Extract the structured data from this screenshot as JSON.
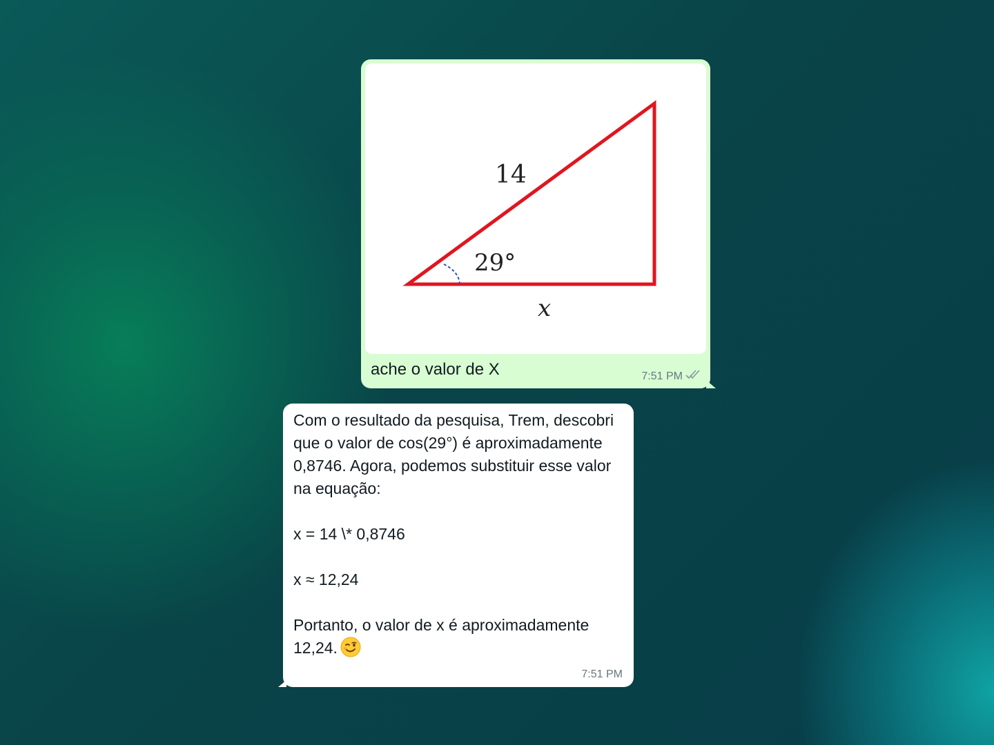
{
  "outgoing_message": {
    "image": {
      "hypotenuse_label": "14",
      "angle_label": "29°",
      "base_label": "x"
    },
    "caption": "ache o valor de X",
    "time": "7:51 PM",
    "status": "read"
  },
  "incoming_message": {
    "paragraphs": [
      "Com o resultado da pesquisa, Trem, descobri que o valor de cos(29°) é aproximadamente 0,8746. Agora, podemos substituir esse valor na equação:",
      "x = 14 \\* 0,8746",
      "x ≈ 12,24",
      "Portanto, o valor de x é aproximadamente 12,24."
    ],
    "emoji": "winking-face",
    "time": "7:51 PM"
  },
  "colors": {
    "outgoing_bubble": "#d9fdd3",
    "incoming_bubble": "#ffffff",
    "triangle_stroke": "#e0161f",
    "angle_arc": "#2f4fb3"
  }
}
